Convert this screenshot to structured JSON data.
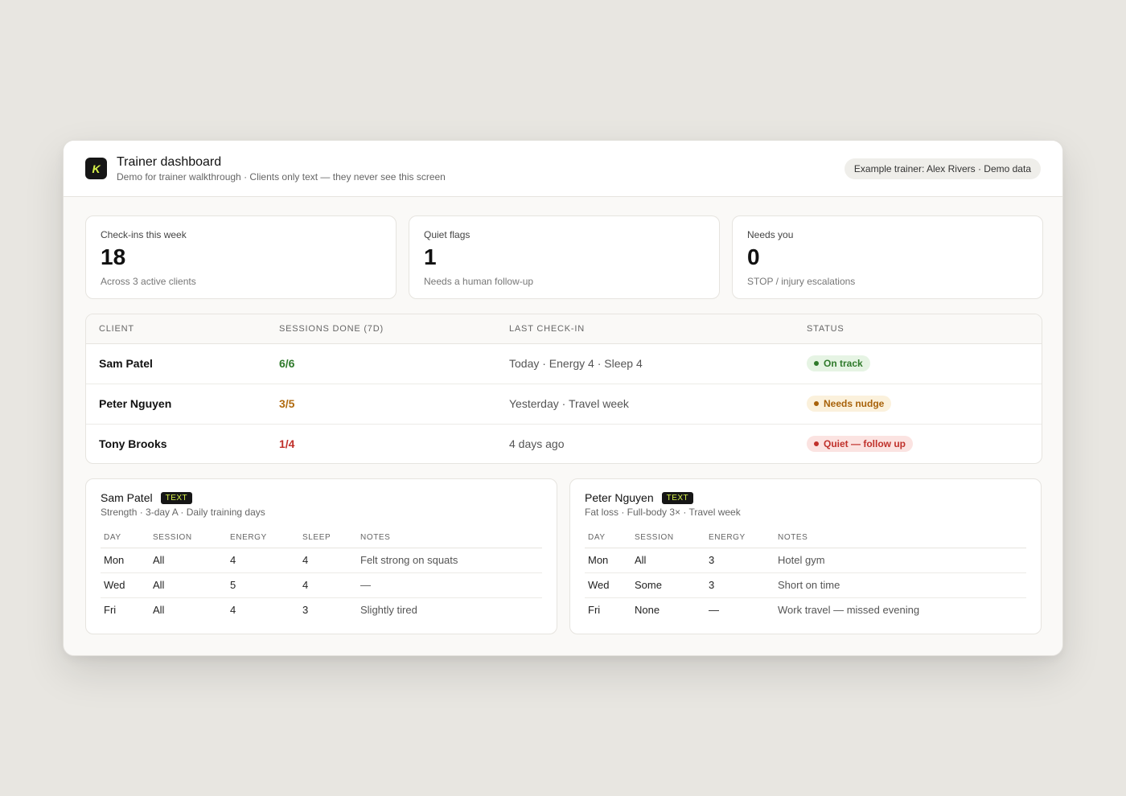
{
  "header": {
    "logo_letter": "K",
    "title": "Trainer dashboard",
    "subtitle": "Demo for trainer walkthrough · Clients only text — they never see this screen",
    "trainer_pill": "Example trainer: Alex Rivers · Demo data"
  },
  "stats": [
    {
      "label": "Check-ins this week",
      "value": "18",
      "note": "Across 3 active clients"
    },
    {
      "label": "Quiet flags",
      "value": "1",
      "note": "Needs a human follow-up"
    },
    {
      "label": "Needs you",
      "value": "0",
      "note": "STOP / injury escalations"
    }
  ],
  "clients_table": {
    "columns": [
      "CLIENT",
      "SESSIONS DONE (7D)",
      "LAST CHECK-IN",
      "STATUS"
    ],
    "rows": [
      {
        "name": "Sam Patel",
        "sessions": "6/6",
        "last_checkin": "Today · Energy 4 · Sleep 4",
        "status": "On track",
        "status_color": "#2f7a2b"
      },
      {
        "name": "Peter Nguyen",
        "sessions": "3/5",
        "last_checkin": "Yesterday · Travel week",
        "status": "Needs nudge",
        "status_color": "#a8620a"
      },
      {
        "name": "Tony Brooks",
        "sessions": "1/4",
        "last_checkin": "4 days ago",
        "status": "Quiet — follow up",
        "status_color": "#c0312b"
      }
    ]
  },
  "details": [
    {
      "name": "Sam Patel",
      "tag": "TEXT",
      "subtitle": "Strength · 3-day A · Daily training days",
      "columns": [
        "DAY",
        "SESSION",
        "ENERGY",
        "SLEEP",
        "NOTES"
      ],
      "rows": [
        [
          "Mon",
          "All",
          "4",
          "4",
          "Felt strong on squats"
        ],
        [
          "Wed",
          "All",
          "5",
          "4",
          "—"
        ],
        [
          "Fri",
          "All",
          "4",
          "3",
          "Slightly tired"
        ]
      ]
    },
    {
      "name": "Peter Nguyen",
      "tag": "TEXT",
      "subtitle": "Fat loss · Full-body 3× · Travel week",
      "columns": [
        "DAY",
        "SESSION",
        "ENERGY",
        "NOTES"
      ],
      "rows": [
        [
          "Mon",
          "All",
          "3",
          "Hotel gym"
        ],
        [
          "Wed",
          "Some",
          "3",
          "Short on time"
        ],
        [
          "Fri",
          "None",
          "—",
          "Work travel — missed evening"
        ]
      ]
    }
  ]
}
